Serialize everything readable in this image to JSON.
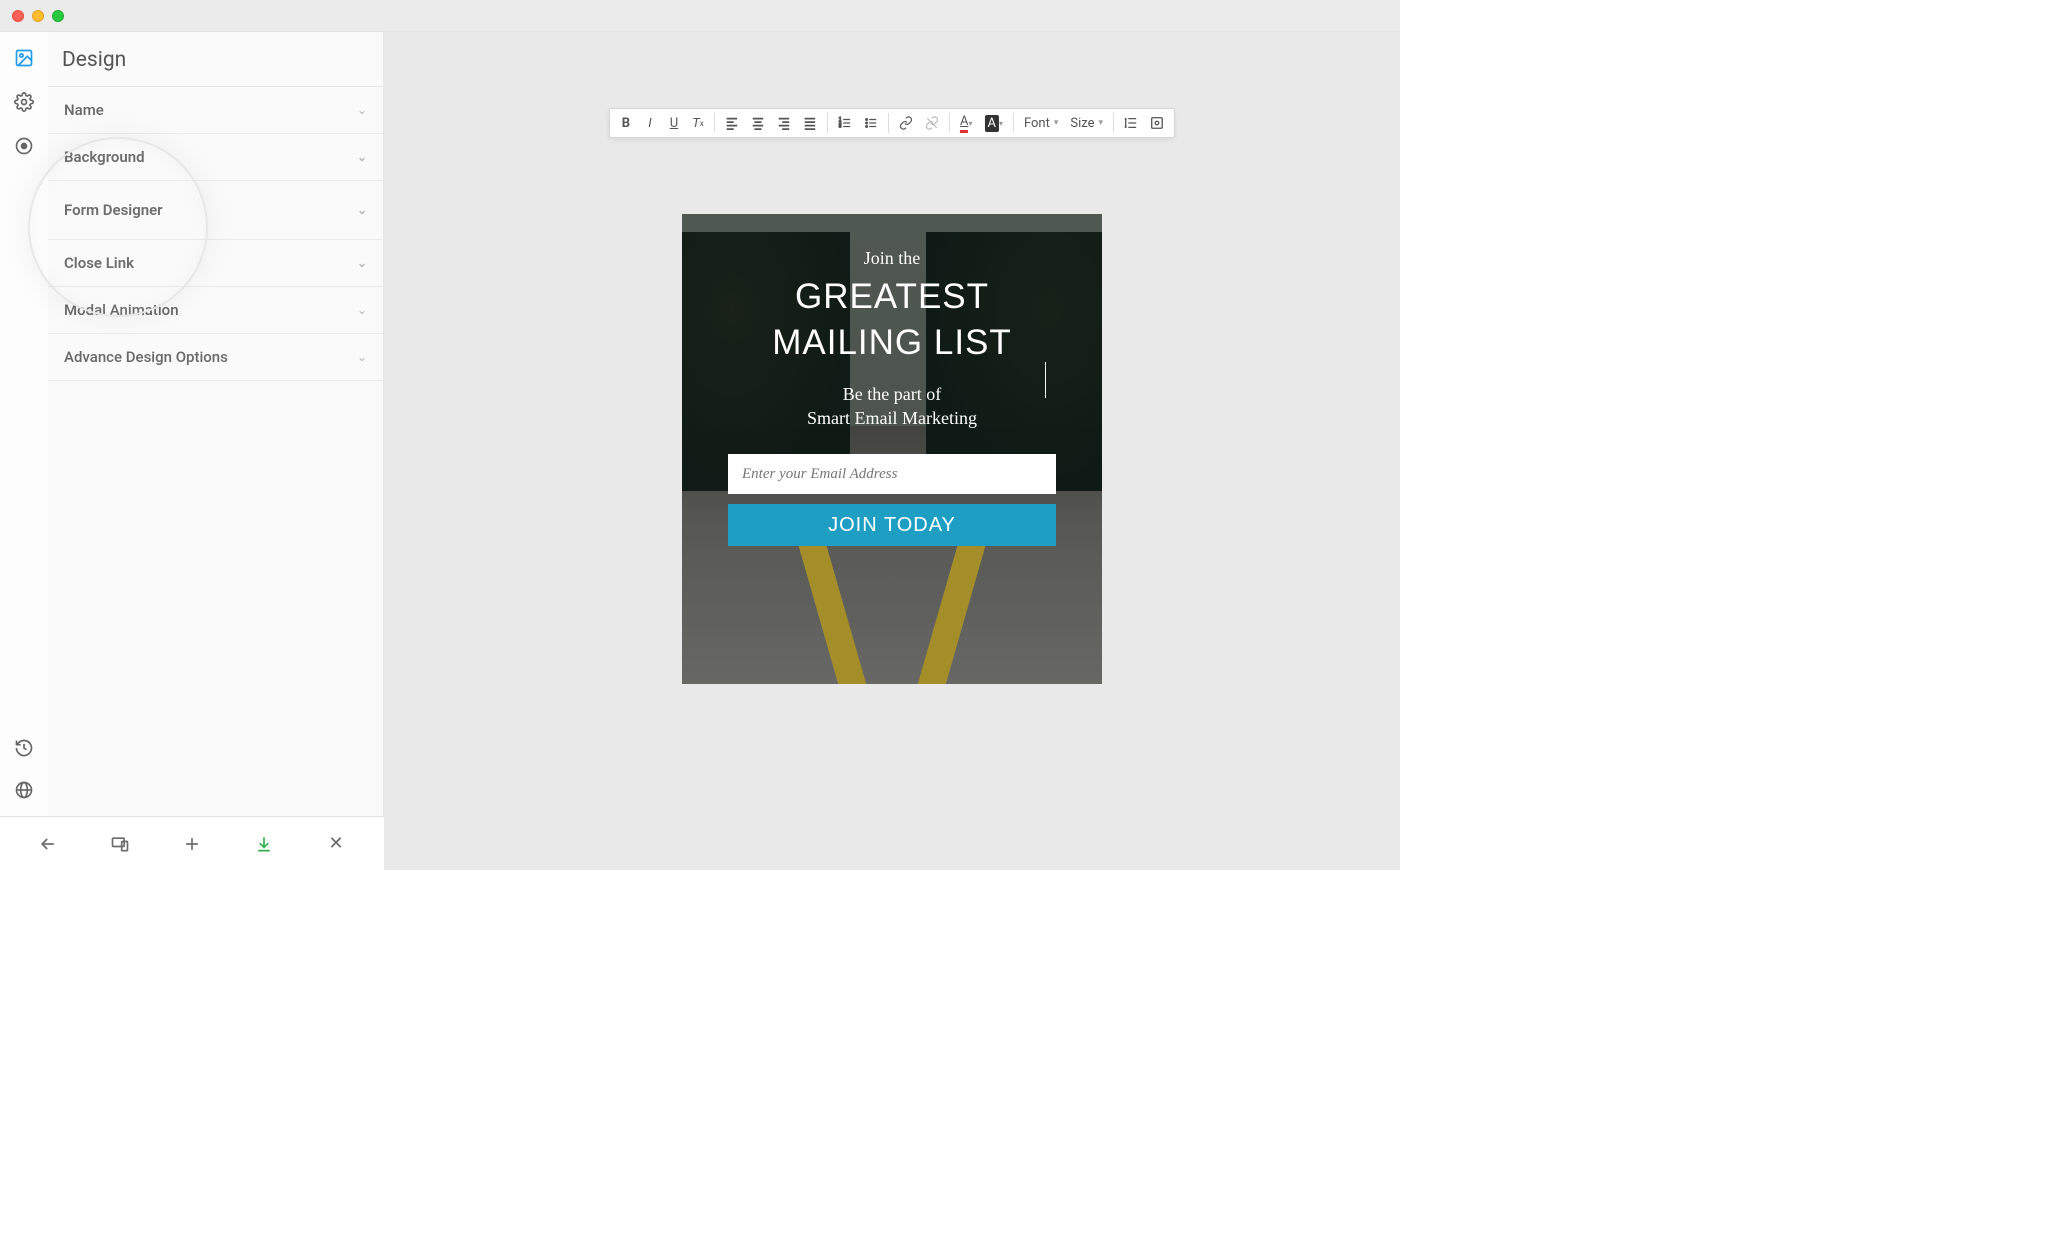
{
  "sidebar": {
    "title": "Design",
    "sections": [
      {
        "label": "Name"
      },
      {
        "label": "Background"
      },
      {
        "label": "Form Designer"
      },
      {
        "label": "Close Link"
      },
      {
        "label": "Modal Animation"
      },
      {
        "label": "Advance Design Options"
      }
    ]
  },
  "rte": {
    "font_label": "Font",
    "size_label": "Size"
  },
  "modal": {
    "pre": "Join the",
    "headline1": "GREATEST",
    "headline2": "MAILING LIST",
    "sub1": "Be the part of",
    "sub2": "Smart Email Marketing",
    "email_placeholder": "Enter your Email Address",
    "cta": "JOIN TODAY"
  },
  "colors": {
    "cta_bg": "#1d9ec2"
  }
}
